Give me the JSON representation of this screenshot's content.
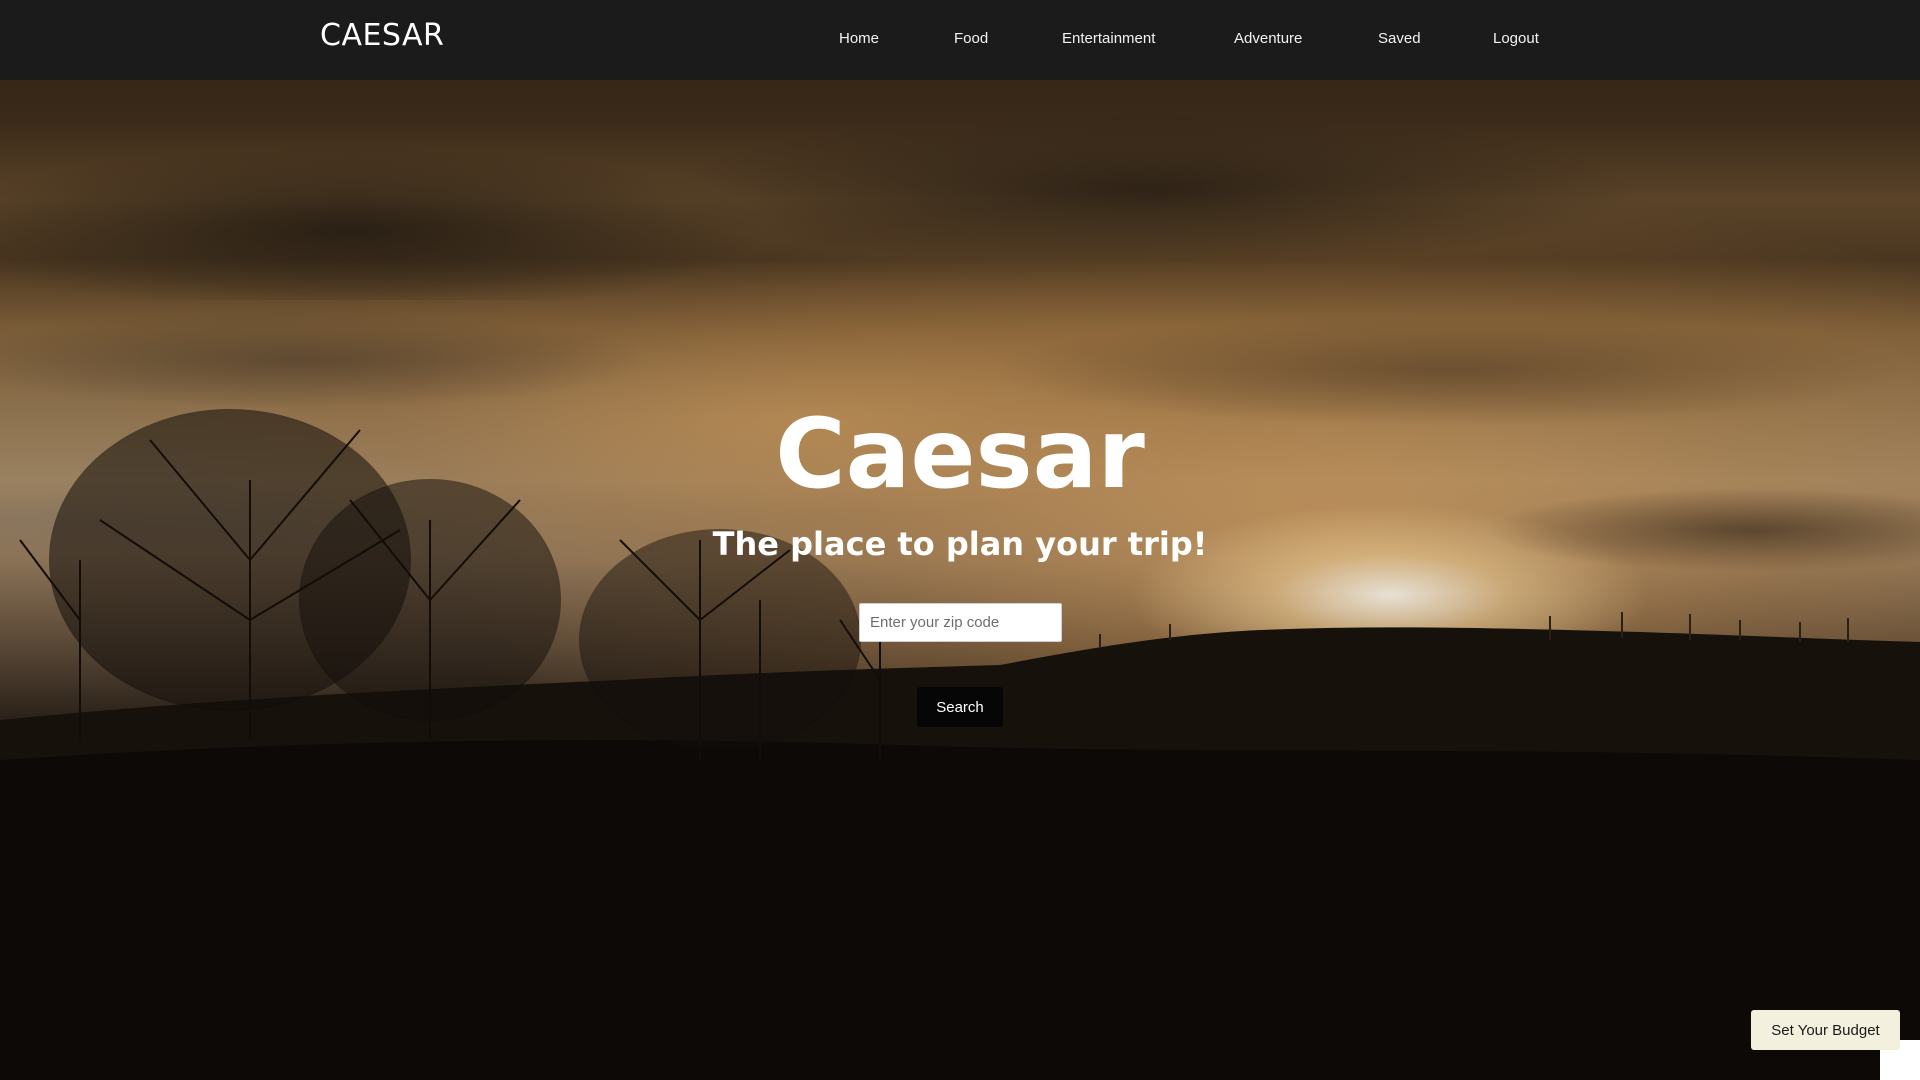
{
  "header": {
    "brand": "CAESAR",
    "nav": [
      {
        "label": "Home"
      },
      {
        "label": "Food"
      },
      {
        "label": "Entertainment"
      },
      {
        "label": "Adventure"
      },
      {
        "label": "Saved"
      },
      {
        "label": "Logout"
      }
    ]
  },
  "hero": {
    "title": "Caesar",
    "subtitle": "The place to plan your trip!",
    "zip_placeholder": "Enter your zip code",
    "search_label": "Search"
  },
  "budget": {
    "button_label": "Set Your Budget"
  },
  "colors": {
    "navbar": "#1b1b1c",
    "search_button": "#060606",
    "budget_button": "#f3f1de",
    "text": "#ffffff"
  }
}
